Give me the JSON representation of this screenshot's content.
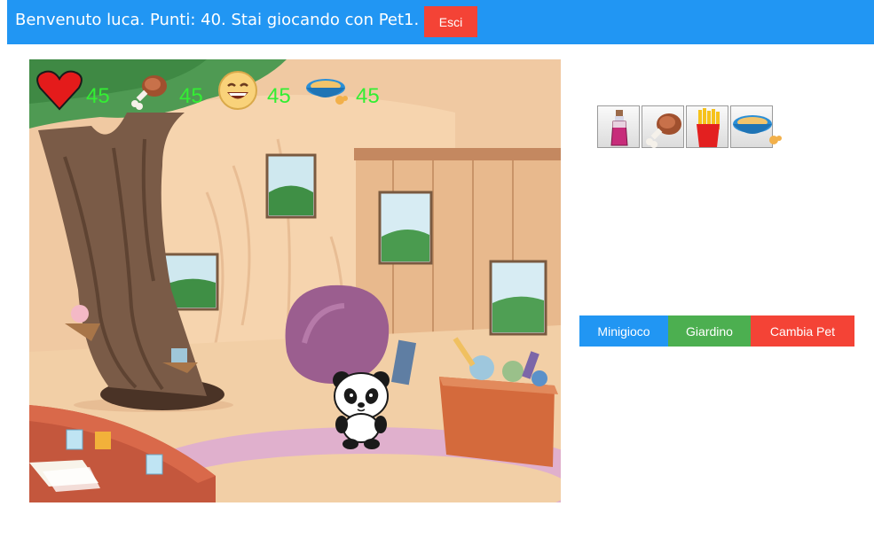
{
  "header": {
    "welcome_text": "Benvenuto luca. Punti: 40. Stai giocando con Pet1.",
    "exit_label": "Esci"
  },
  "stats": [
    {
      "icon": "heart-icon",
      "value": "45"
    },
    {
      "icon": "meat-icon",
      "value": "45"
    },
    {
      "icon": "happy-face-icon",
      "value": "45"
    },
    {
      "icon": "food-bowl-icon",
      "value": "45"
    }
  ],
  "inventory": [
    {
      "icon": "potion-icon"
    },
    {
      "icon": "meat-icon"
    },
    {
      "icon": "fries-icon"
    },
    {
      "icon": "food-bowl-icon"
    }
  ],
  "actions": {
    "minigame_label": "Minigioco",
    "garden_label": "Giardino",
    "change_pet_label": "Cambia Pet"
  },
  "colors": {
    "header_bg": "#2196f3",
    "exit_bg": "#f44336",
    "minigame_bg": "#2196f3",
    "garden_bg": "#4caf50",
    "change_pet_bg": "#f44336",
    "stat_text": "#33ee33"
  }
}
